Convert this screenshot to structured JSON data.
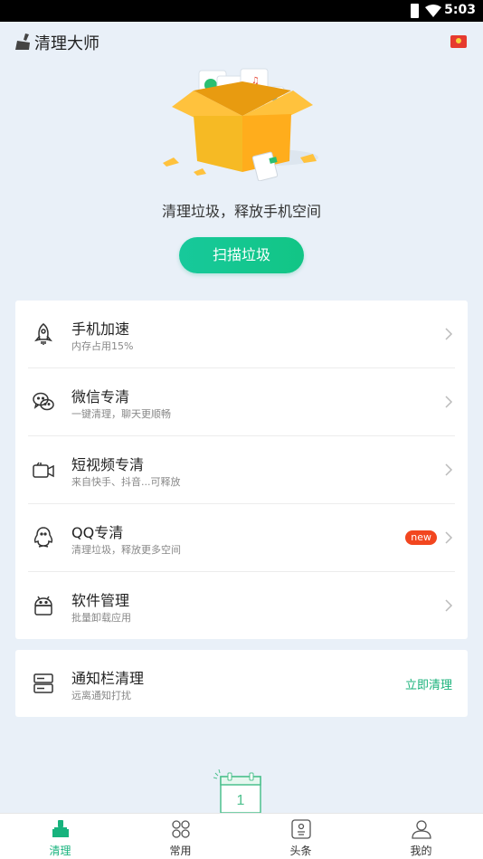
{
  "status_bar": {
    "time": "5:03"
  },
  "header": {
    "title": "清理大师"
  },
  "hero": {
    "subtitle": "清理垃圾，释放手机空间",
    "scan_button": "扫描垃圾"
  },
  "features": [
    {
      "title": "手机加速",
      "subtitle": "内存占用15%",
      "icon": "rocket-icon"
    },
    {
      "title": "微信专清",
      "subtitle": "一键清理，聊天更顺畅",
      "icon": "wechat-icon"
    },
    {
      "title": "短视频专清",
      "subtitle": "来自快手、抖音...可释放",
      "icon": "video-camera-icon"
    },
    {
      "title": "QQ专清",
      "subtitle": "清理垃圾，释放更多空间",
      "icon": "qq-penguin-icon",
      "badge": "new"
    },
    {
      "title": "软件管理",
      "subtitle": "批量卸载应用",
      "icon": "android-icon"
    }
  ],
  "notify": {
    "title": "通知栏清理",
    "subtitle": "远离通知打扰",
    "action": "立即清理",
    "icon": "notification-bar-icon"
  },
  "calendar": {
    "day": "1"
  },
  "tabs": [
    {
      "label": "清理",
      "icon": "broom-icon",
      "active": true
    },
    {
      "label": "常用",
      "icon": "grid-icon",
      "active": false
    },
    {
      "label": "头条",
      "icon": "news-icon",
      "active": false
    },
    {
      "label": "我的",
      "icon": "profile-icon",
      "active": false
    }
  ],
  "colors": {
    "accent": "#17c99b",
    "badge": "#f2461f",
    "link": "#18b27a",
    "background": "#e9f0f8"
  }
}
